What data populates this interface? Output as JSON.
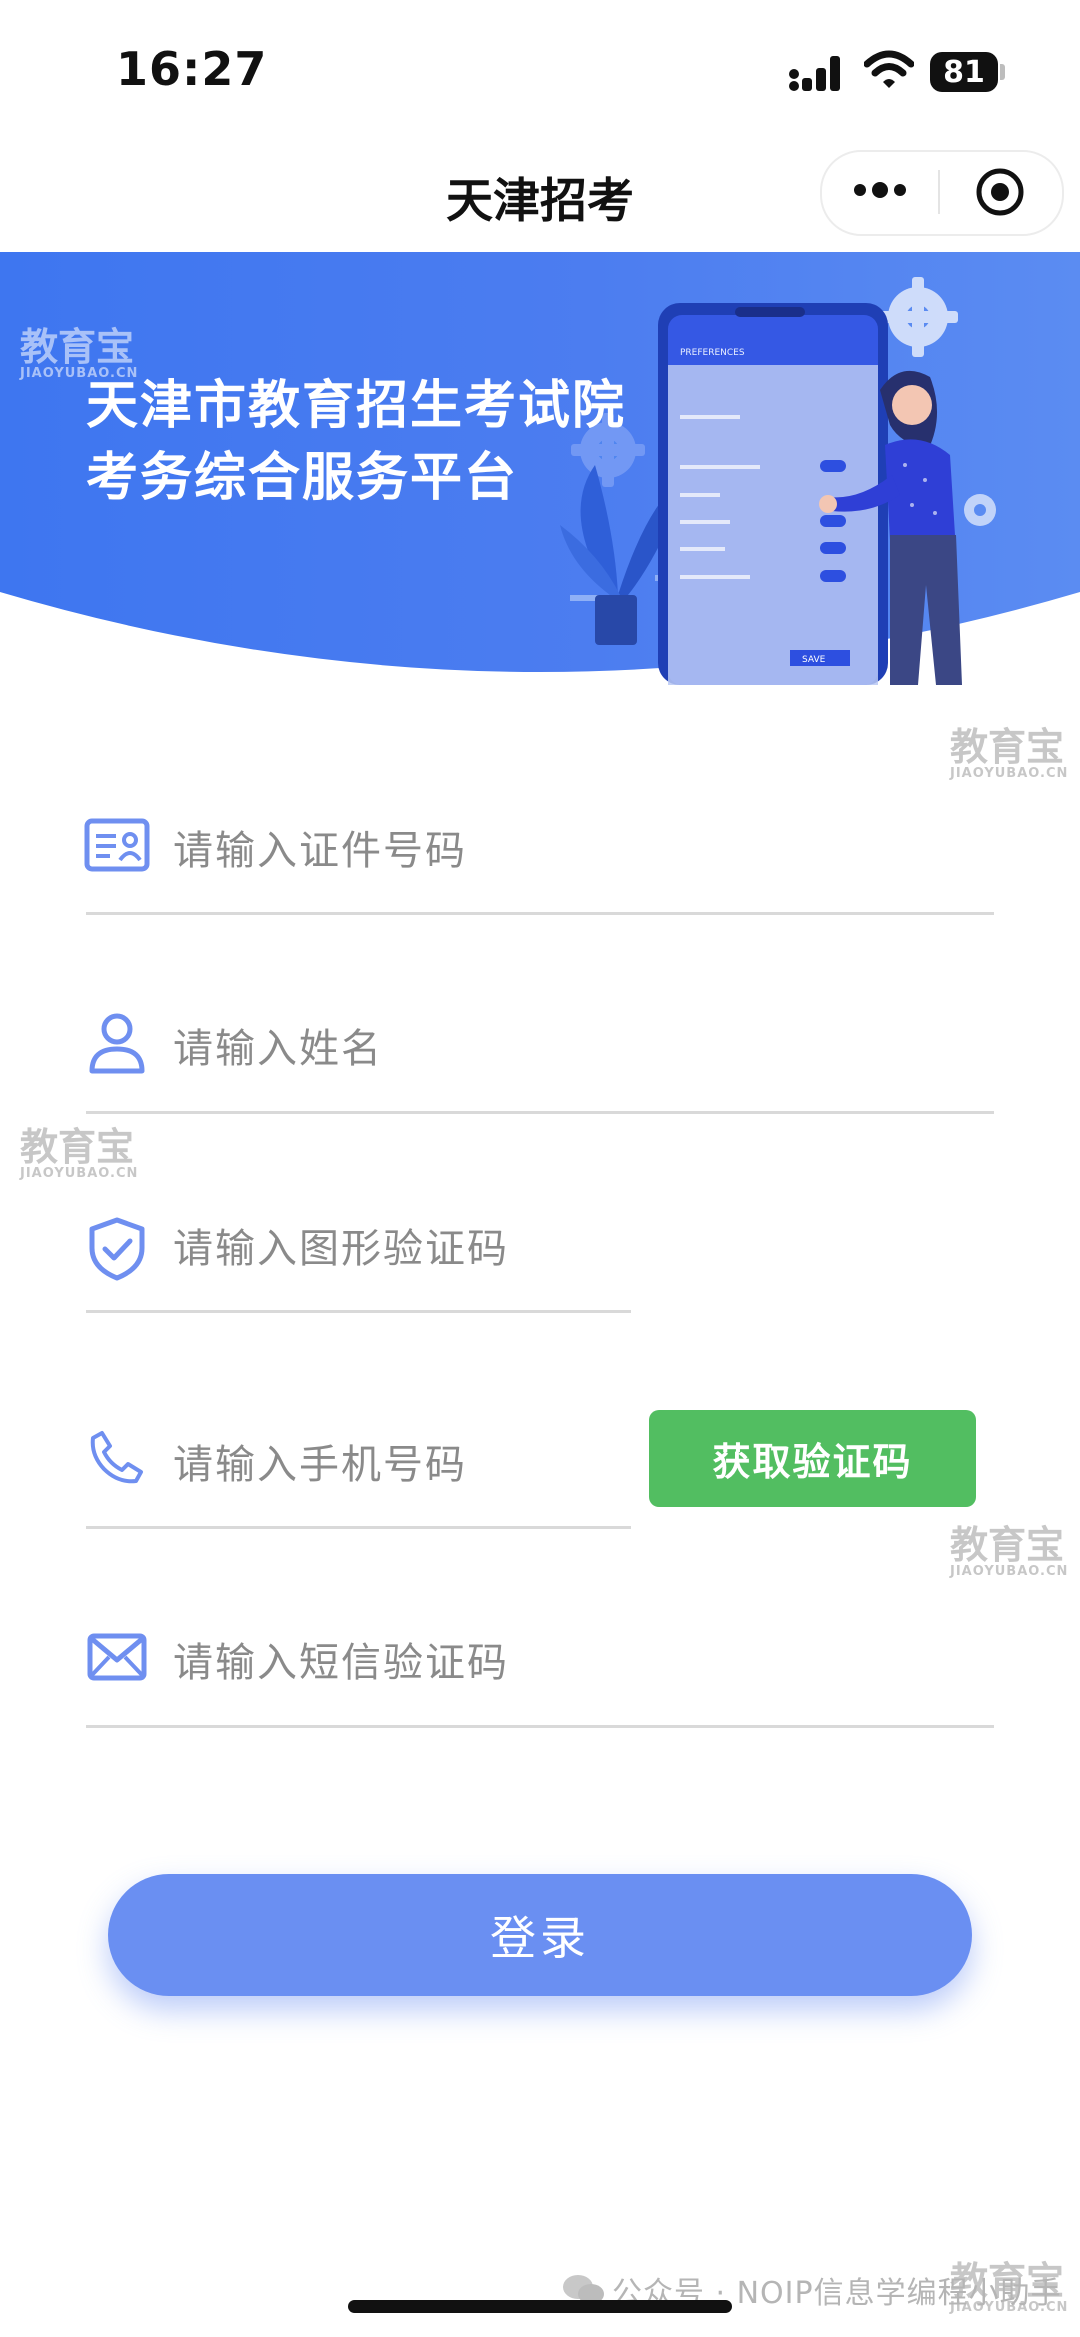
{
  "status_bar": {
    "time": "16:27",
    "battery": "81"
  },
  "nav": {
    "title": "天津招考"
  },
  "banner": {
    "title_line1": "天津市教育招生考试院",
    "title_line2": "考务综合服务平台",
    "phone_header": "PREFERENCES",
    "phone_save": "SAVE"
  },
  "watermark": {
    "text": "教育宝",
    "sub": "JIAOYUBAO.CN"
  },
  "form": {
    "id_placeholder": "请输入证件号码",
    "name_placeholder": "请输入姓名",
    "captcha_placeholder": "请输入图形验证码",
    "phone_placeholder": "请输入手机号码",
    "sms_placeholder": "请输入短信验证码",
    "get_code_label": "获取验证码"
  },
  "login": {
    "label": "登录"
  },
  "footer": {
    "text": "公众号 · NOIP信息学编程小助手"
  },
  "colors": {
    "primary": "#6a8ff2",
    "banner": "#4c7df0",
    "green": "#52be61",
    "icon": "#6f8ff0"
  },
  "icons": [
    "signal-icon",
    "wifi-icon",
    "battery-icon",
    "more-icon",
    "close-mini-icon",
    "id-card-icon",
    "user-icon",
    "shield-icon",
    "phone-icon",
    "mail-icon",
    "wechat-icon"
  ]
}
